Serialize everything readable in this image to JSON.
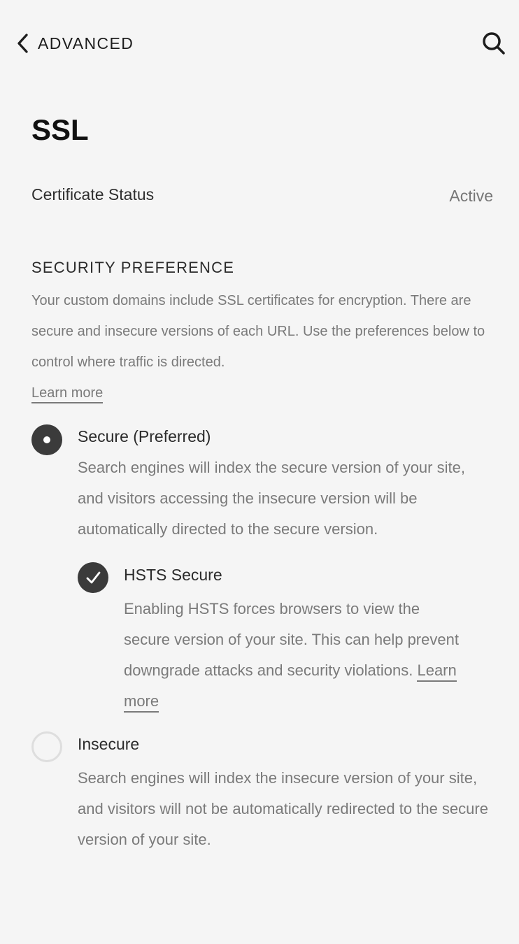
{
  "header": {
    "back_label": "ADVANCED",
    "back_icon": "chevron-left-icon",
    "search_icon": "search-icon"
  },
  "page": {
    "title": "SSL"
  },
  "certificate": {
    "label": "Certificate Status",
    "value": "Active"
  },
  "security": {
    "heading": "SECURITY PREFERENCE",
    "description": "Your custom domains include SSL certificates for encryption. There are secure and insecure versions of each URL. Use the preferences below to control where traffic is directed.",
    "learn_more": "Learn more",
    "options": [
      {
        "label": "Secure (Preferred)",
        "selected": true,
        "description": "Search engines will index the secure version of your site, and visitors accessing the insecure version will be automatically directed to the secure version."
      },
      {
        "label": "Insecure",
        "selected": false,
        "description": "Search engines will index the insecure version of your site, and visitors will not be automatically redirected to the secure version of your site."
      }
    ],
    "hsts": {
      "label": "HSTS Secure",
      "checked": true,
      "description": "Enabling HSTS forces browsers to view the secure version of your site. This can help prevent downgrade attacks and security violations.",
      "learn_more": "Learn more"
    }
  },
  "colors": {
    "background": "#f5f5f5",
    "selected_control": "#3b3b3b",
    "muted_text": "#7a7a7a",
    "unselected_border": "#dedede"
  }
}
